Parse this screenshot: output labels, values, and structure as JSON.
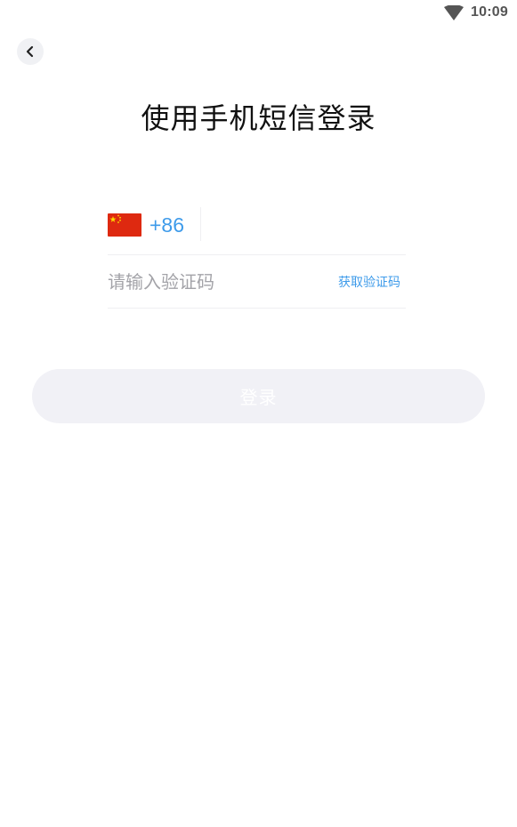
{
  "status_bar": {
    "time": "10:09",
    "wifi_icon": "wifi-icon"
  },
  "header": {
    "back_icon": "chevron-left-icon"
  },
  "title": "使用手机短信登录",
  "phone": {
    "flag_icon": "china-flag-icon",
    "country_code": "+86",
    "value": "",
    "placeholder": ""
  },
  "code": {
    "value": "",
    "placeholder": "请输入验证码",
    "get_code_label": "获取验证码"
  },
  "login_button_label": "登录",
  "colors": {
    "accent": "#3e9bea",
    "button_disabled_bg": "#f1f1f6",
    "flag_red": "#de2910",
    "flag_yellow": "#ffde00"
  }
}
